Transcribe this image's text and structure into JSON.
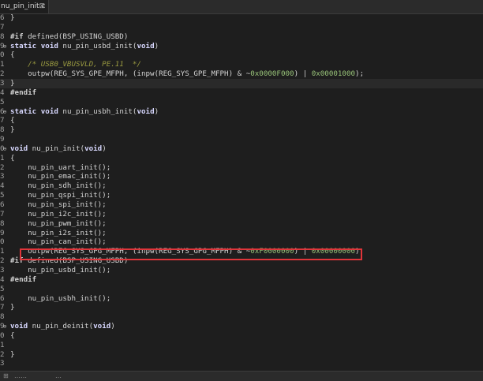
{
  "tab": {
    "title": "nu_pin_init.c",
    "close_glyph": "⊠"
  },
  "lines": [
    {
      "ln": "6",
      "fold": "",
      "segs": [
        {
          "t": "}",
          "c": ""
        }
      ]
    },
    {
      "ln": "7",
      "fold": "",
      "segs": []
    },
    {
      "ln": "8",
      "fold": "",
      "segs": [
        {
          "t": "#if",
          "c": "pp"
        },
        {
          "t": " defined(BSP_USING_USBD)",
          "c": ""
        }
      ]
    },
    {
      "ln": "9",
      "fold": "⊖",
      "segs": [
        {
          "t": "static",
          "c": "kw"
        },
        {
          "t": " ",
          "c": ""
        },
        {
          "t": "void",
          "c": "kw"
        },
        {
          "t": " nu_pin_usbd_init(",
          "c": ""
        },
        {
          "t": "void",
          "c": "kw"
        },
        {
          "t": ")",
          "c": ""
        }
      ]
    },
    {
      "ln": "0",
      "fold": "",
      "segs": [
        {
          "t": "{",
          "c": ""
        }
      ]
    },
    {
      "ln": "1",
      "fold": "",
      "segs": [
        {
          "t": "    ",
          "c": ""
        },
        {
          "t": "/* USB0_VBUSVLD, PE.11  */",
          "c": "cm"
        }
      ]
    },
    {
      "ln": "2",
      "fold": "",
      "segs": [
        {
          "t": "    outpw(REG_SYS_GPE_MFPH, (inpw(REG_SYS_GPE_MFPH) & ~",
          "c": ""
        },
        {
          "t": "0x0000F000",
          "c": "num"
        },
        {
          "t": ") | ",
          "c": ""
        },
        {
          "t": "0x00001000",
          "c": "num"
        },
        {
          "t": ");",
          "c": ""
        }
      ]
    },
    {
      "ln": "3",
      "fold": "",
      "segs": [
        {
          "t": "}",
          "c": ""
        }
      ]
    },
    {
      "ln": "4",
      "fold": "",
      "segs": [
        {
          "t": "#endif",
          "c": "pp"
        }
      ]
    },
    {
      "ln": "5",
      "fold": "",
      "segs": []
    },
    {
      "ln": "6",
      "fold": "⊖",
      "segs": [
        {
          "t": "static",
          "c": "kw"
        },
        {
          "t": " ",
          "c": ""
        },
        {
          "t": "void",
          "c": "kw"
        },
        {
          "t": " nu_pin_usbh_init(",
          "c": ""
        },
        {
          "t": "void",
          "c": "kw"
        },
        {
          "t": ")",
          "c": ""
        }
      ]
    },
    {
      "ln": "7",
      "fold": "",
      "segs": [
        {
          "t": "{",
          "c": ""
        }
      ]
    },
    {
      "ln": "8",
      "fold": "",
      "segs": [
        {
          "t": "}",
          "c": ""
        }
      ]
    },
    {
      "ln": "9",
      "fold": "",
      "segs": []
    },
    {
      "ln": "0",
      "fold": "⊖",
      "segs": [
        {
          "t": "void",
          "c": "kw"
        },
        {
          "t": " nu_pin_init(",
          "c": ""
        },
        {
          "t": "void",
          "c": "kw"
        },
        {
          "t": ")",
          "c": ""
        }
      ]
    },
    {
      "ln": "1",
      "fold": "",
      "segs": [
        {
          "t": "{",
          "c": ""
        }
      ]
    },
    {
      "ln": "2",
      "fold": "",
      "segs": [
        {
          "t": "    nu_pin_uart_init();",
          "c": ""
        }
      ]
    },
    {
      "ln": "3",
      "fold": "",
      "segs": [
        {
          "t": "    nu_pin_emac_init();",
          "c": ""
        }
      ]
    },
    {
      "ln": "4",
      "fold": "",
      "segs": [
        {
          "t": "    nu_pin_sdh_init();",
          "c": ""
        }
      ]
    },
    {
      "ln": "5",
      "fold": "",
      "segs": [
        {
          "t": "    nu_pin_qspi_init();",
          "c": ""
        }
      ]
    },
    {
      "ln": "6",
      "fold": "",
      "segs": [
        {
          "t": "    nu_pin_spi_init();",
          "c": ""
        }
      ]
    },
    {
      "ln": "7",
      "fold": "",
      "segs": [
        {
          "t": "    nu_pin_i2c_init();",
          "c": ""
        }
      ]
    },
    {
      "ln": "8",
      "fold": "",
      "segs": [
        {
          "t": "    nu_pin_pwm_init();",
          "c": ""
        }
      ]
    },
    {
      "ln": "9",
      "fold": "",
      "segs": [
        {
          "t": "    nu_pin_i2s_init();",
          "c": ""
        }
      ]
    },
    {
      "ln": "0",
      "fold": "",
      "segs": [
        {
          "t": "    nu_pin_can_init();",
          "c": ""
        }
      ]
    },
    {
      "ln": "1",
      "fold": "",
      "segs": [
        {
          "t": "    outpw(REG_SYS_GPG_MFPH, (inpw(REG_SYS_GPG_MFPH) & ~",
          "c": ""
        },
        {
          "t": "0xF0000000",
          "c": "num"
        },
        {
          "t": ") | ",
          "c": ""
        },
        {
          "t": "0x00000000",
          "c": "num"
        },
        {
          "t": ");",
          "c": ""
        }
      ]
    },
    {
      "ln": "2",
      "fold": "",
      "segs": [
        {
          "t": "#if",
          "c": "pp"
        },
        {
          "t": " defined(BSP_USING_USBD)",
          "c": ""
        }
      ]
    },
    {
      "ln": "3",
      "fold": "",
      "segs": [
        {
          "t": "    nu_pin_usbd_init();",
          "c": ""
        }
      ]
    },
    {
      "ln": "4",
      "fold": "",
      "segs": [
        {
          "t": "#endif",
          "c": "pp"
        }
      ]
    },
    {
      "ln": "5",
      "fold": "",
      "segs": []
    },
    {
      "ln": "6",
      "fold": "",
      "segs": [
        {
          "t": "    nu_pin_usbh_init();",
          "c": ""
        }
      ]
    },
    {
      "ln": "7",
      "fold": "",
      "segs": [
        {
          "t": "}",
          "c": ""
        }
      ]
    },
    {
      "ln": "8",
      "fold": "",
      "segs": []
    },
    {
      "ln": "9",
      "fold": "⊖",
      "segs": [
        {
          "t": "void",
          "c": "kw"
        },
        {
          "t": " nu_pin_deinit(",
          "c": ""
        },
        {
          "t": "void",
          "c": "kw"
        },
        {
          "t": ")",
          "c": ""
        }
      ]
    },
    {
      "ln": "0",
      "fold": "",
      "segs": [
        {
          "t": "{",
          "c": ""
        }
      ]
    },
    {
      "ln": "1",
      "fold": "",
      "segs": []
    },
    {
      "ln": "2",
      "fold": "",
      "segs": [
        {
          "t": "}",
          "c": ""
        }
      ]
    },
    {
      "ln": "3",
      "fold": "",
      "segs": []
    }
  ],
  "current_line_index": 7,
  "highlight": {
    "color": "#e0353a"
  },
  "status": {
    "items": [
      "⊞",
      "……",
      "…"
    ]
  }
}
